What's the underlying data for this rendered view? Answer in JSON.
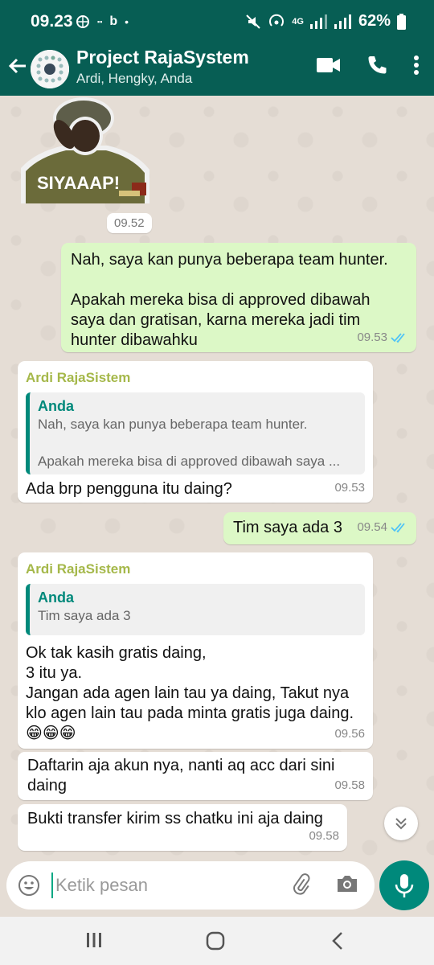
{
  "status_bar": {
    "time": "09.23",
    "network": "4G",
    "battery": "62%"
  },
  "header": {
    "title": "Project RajaSystem",
    "members": "Ardi, Hengky, Anda"
  },
  "sticker": {
    "caption": "SIYAAAP!",
    "time": "09.52"
  },
  "messages": [
    {
      "text": "Nah, saya kan punya beberapa team hunter.\n\nApakah mereka bisa di approved dibawah saya dan gratisan, karna mereka jadi tim hunter dibawahku",
      "time": "09.53"
    },
    {
      "sender": "Ardi RajaSistem",
      "quote_name": "Anda",
      "quote_text": "Nah, saya kan punya beberapa team hunter.\n\nApakah mereka bisa di approved dibawah saya ...",
      "text": "Ada brp pengguna itu daing?",
      "time": "09.53"
    },
    {
      "text": "Tim saya ada 3",
      "time": "09.54"
    },
    {
      "sender": "Ardi RajaSistem",
      "quote_name": "Anda",
      "quote_text": "Tim saya ada 3",
      "text": "Ok tak kasih gratis daing,\n3 itu ya.\nJangan ada agen lain tau ya daing, Takut nya klo agen lain tau pada minta gratis juga daing.😁😁😁",
      "time": "09.56"
    },
    {
      "text": "Daftarin aja akun nya, nanti aq acc dari sini daing",
      "time": "09.58"
    },
    {
      "text": "Bukti transfer kirim ss chatku ini aja daing",
      "time": "09.58"
    }
  ],
  "input": {
    "placeholder": "Ketik pesan"
  },
  "colors": {
    "header": "#075e54",
    "outgoing": "#dcf8c6",
    "incoming": "#ffffff",
    "accent": "#00897b",
    "sender": "#a5b84a",
    "read_ticks": "#4fc3f7"
  }
}
